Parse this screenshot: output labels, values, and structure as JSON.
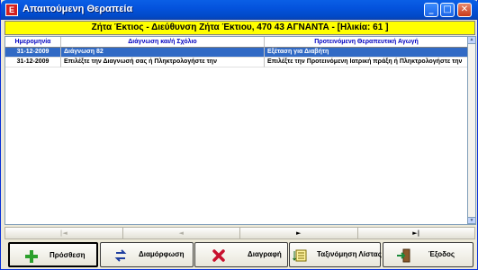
{
  "window": {
    "title": "Απαιτούμενη Θεραπεία",
    "icon_text": "E",
    "controls": {
      "minimize": "_",
      "maximize": "□",
      "close": "✕"
    }
  },
  "patient_banner": "Ζήτα Έκτιος - Διεύθυνση Ζήτα Έκτιου, 470 43 ΑΓΝΑΝΤΑ - [Ηλικία: 61 ]",
  "grid": {
    "columns": [
      "Ημερομηνία",
      "Διάγνωση και/ή Σχόλιο",
      "Προτεινόμενη Θεραπευτική Αγωγή"
    ],
    "rows": [
      {
        "date": "31-12-2009",
        "diagnosis": "Διάγνωση 82",
        "treatment": "Εξέταση για Διαβήτη",
        "selected": true
      },
      {
        "date": "31-12-2009",
        "diagnosis": "Επιλέξτε την Διαγνωσή σας ή Πληκτρολογήστε την",
        "treatment": "Επιλέξτε την Προτεινόμενη Ιατρική πράξη ή Πληκτρολογήστε την",
        "selected": false
      }
    ]
  },
  "navigator": {
    "first": "|◄",
    "prev": "◄",
    "next": "►",
    "last": "►|"
  },
  "actions": {
    "add": "Πρόσθεση",
    "configure": "Διαμόρφωση",
    "delete": "Διαγραφή",
    "sort": "Ταξινόμηση Λίστας",
    "exit": "Έξοδος"
  },
  "colors": {
    "banner": "#ffff00",
    "selected_row": "#316ac5",
    "header_text": "#0000c0"
  }
}
